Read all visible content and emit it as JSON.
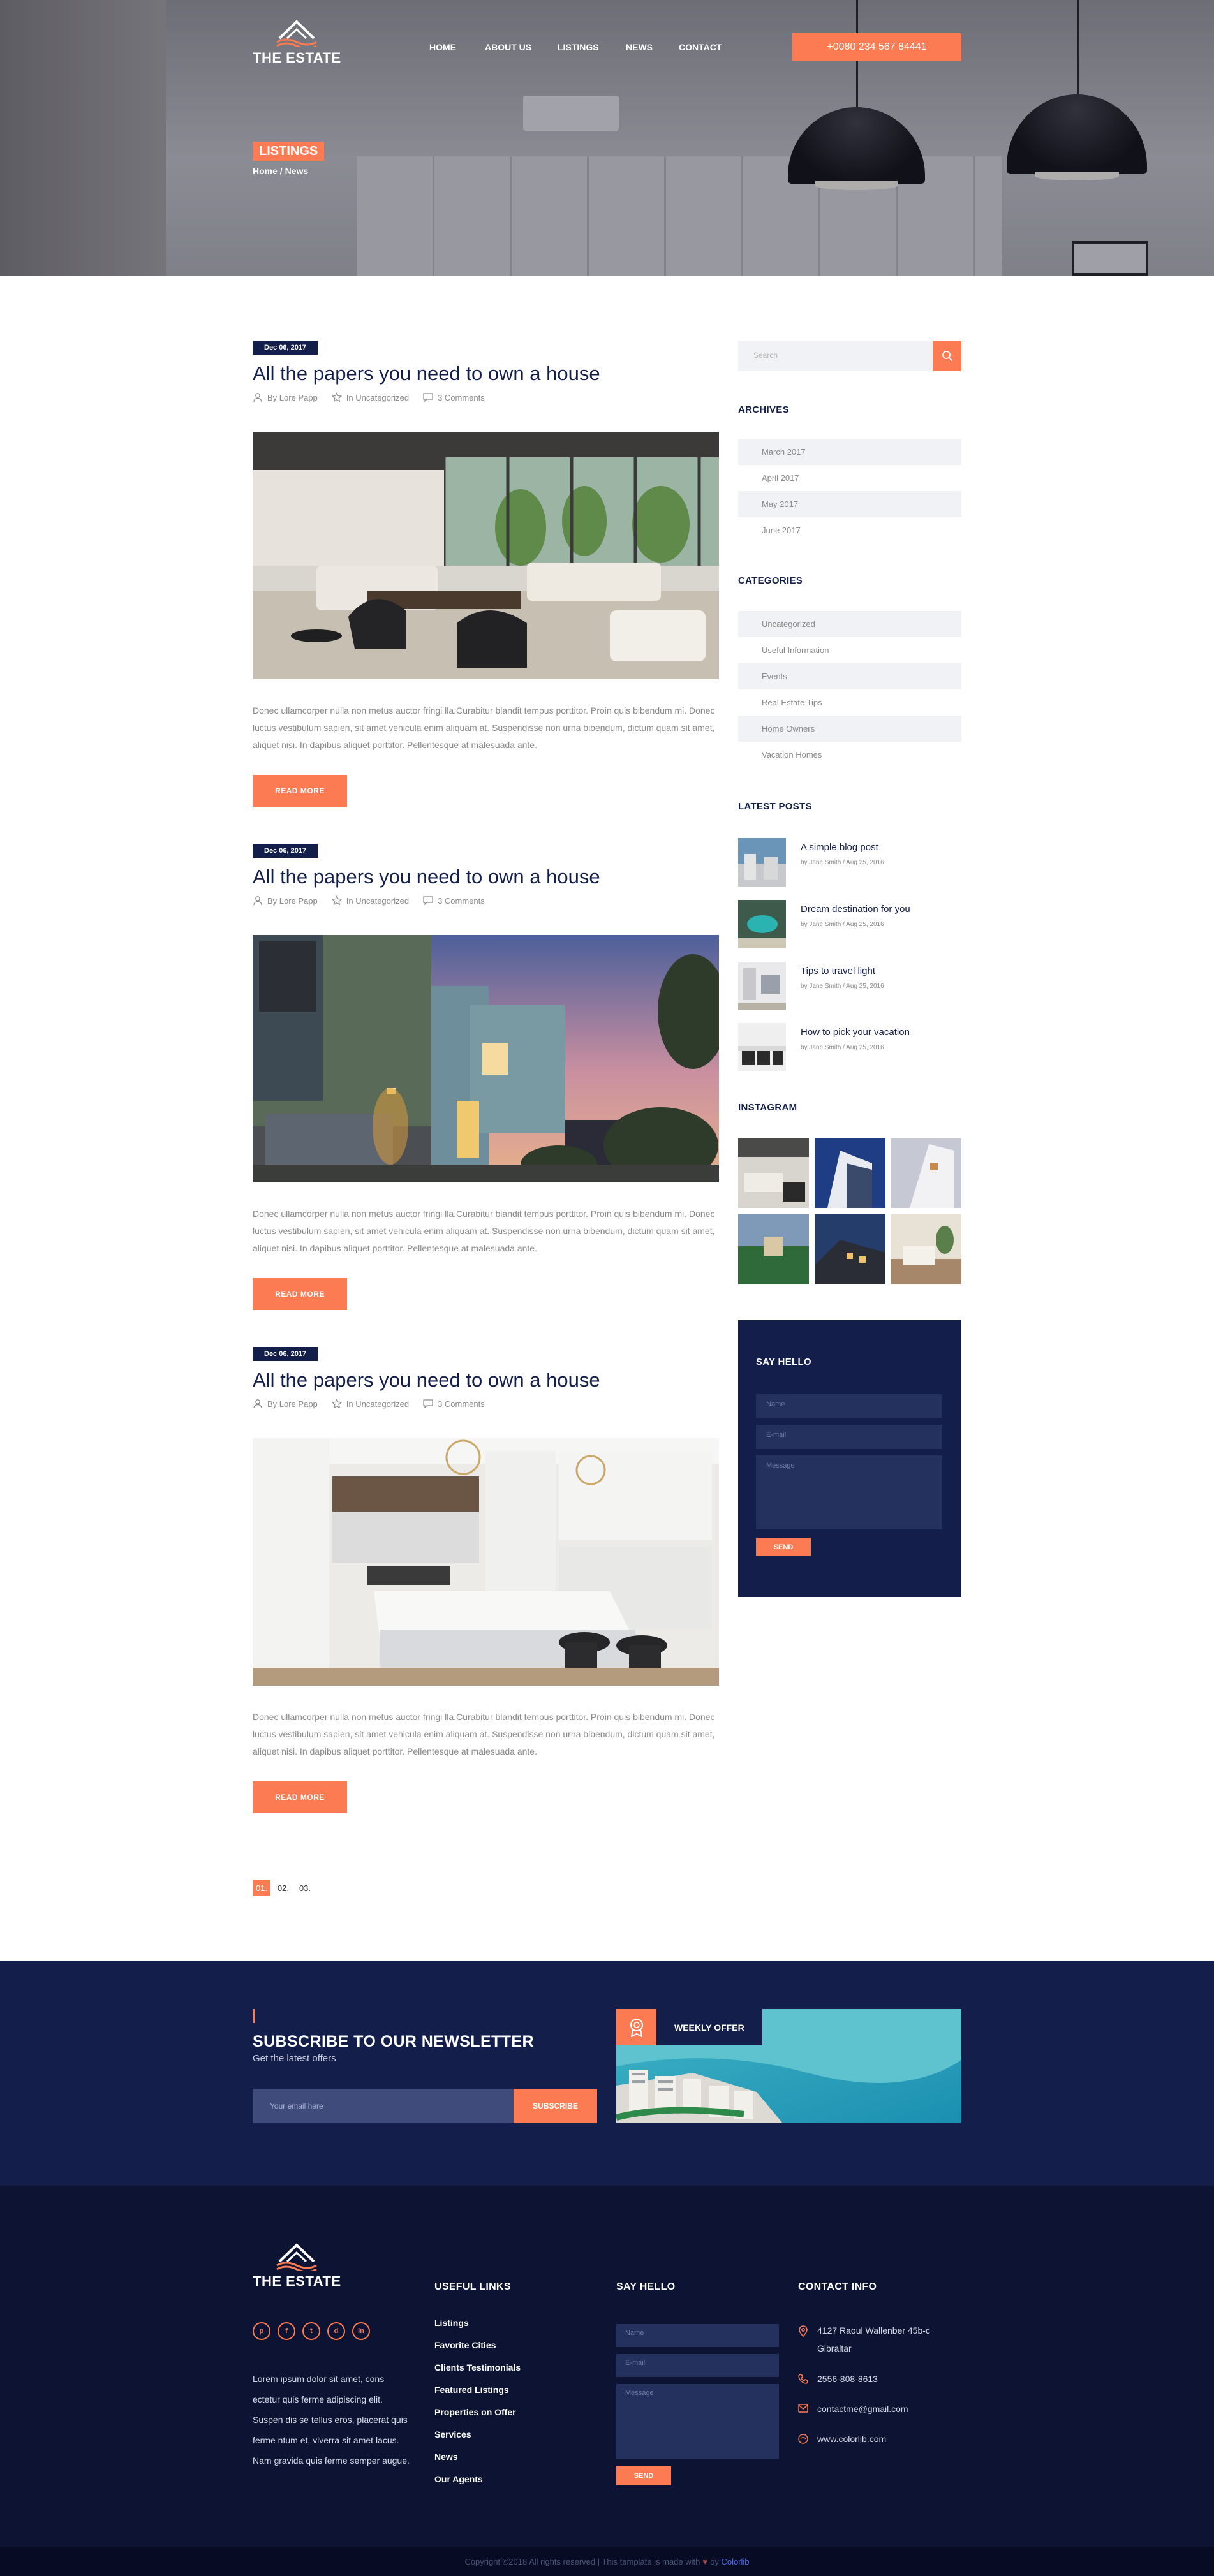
{
  "colors": {
    "accent": "#fd7b52",
    "navy": "#131e4a",
    "footer": "#0d1433"
  },
  "header": {
    "logo_text": "THE ESTATE",
    "nav": [
      "HOME",
      "ABOUT US",
      "LISTINGS",
      "NEWS",
      "CONTACT"
    ],
    "phone": "+0080 234 567 84441",
    "page_title": "LISTINGS",
    "breadcrumb": "Home / News"
  },
  "posts": [
    {
      "date": "Dec 06, 2017",
      "title": "All the papers you need to own a house",
      "author": "By Lore Papp",
      "category": "In Uncategorized",
      "comments": "3 Comments",
      "excerpt": "Donec ullamcorper nulla non metus auctor fringi lla.Curabitur blandit tempus porttitor. Proin quis bibendum mi. Donec luctus vestibulum sapien, sit amet vehicula enim aliquam at. Suspendisse non urna bibendum, dictum quam sit amet, aliquet nisi. In dapibus aliquet porttitor. Pellentesque at malesuada ante.",
      "read_more": "READ MORE"
    },
    {
      "date": "Dec 06, 2017",
      "title": "All the papers you need to own a house",
      "author": "By Lore Papp",
      "category": "In Uncategorized",
      "comments": "3 Comments",
      "excerpt": "Donec ullamcorper nulla non metus auctor fringi lla.Curabitur blandit tempus porttitor. Proin quis bibendum mi. Donec luctus vestibulum sapien, sit amet vehicula enim aliquam at. Suspendisse non urna bibendum, dictum quam sit amet, aliquet nisi. In dapibus aliquet porttitor. Pellentesque at malesuada ante.",
      "read_more": "READ MORE"
    },
    {
      "date": "Dec 06, 2017",
      "title": "All the papers you need to own a house",
      "author": "By Lore Papp",
      "category": "In Uncategorized",
      "comments": "3 Comments",
      "excerpt": "Donec ullamcorper nulla non metus auctor fringi lla.Curabitur blandit tempus porttitor. Proin quis bibendum mi. Donec luctus vestibulum sapien, sit amet vehicula enim aliquam at. Suspendisse non urna bibendum, dictum quam sit amet, aliquet nisi. In dapibus aliquet porttitor. Pellentesque at malesuada ante.",
      "read_more": "READ MORE"
    }
  ],
  "pagination": [
    "01.",
    "02.",
    "03."
  ],
  "sidebar": {
    "search_placeholder": "Search",
    "archives_title": "ARCHIVES",
    "archives": [
      "March 2017",
      "April 2017",
      "May 2017",
      "June 2017"
    ],
    "categories_title": "CATEGORIES",
    "categories": [
      "Uncategorized",
      "Useful Information",
      "Events",
      "Real Estate Tips",
      "Home Owners",
      "Vacation Homes"
    ],
    "latest_title": "LATEST POSTS",
    "latest": [
      {
        "title": "A simple blog post",
        "sub": "by Jane Smith / Aug 25, 2016"
      },
      {
        "title": "Dream destination for you",
        "sub": "by Jane Smith / Aug 25, 2016"
      },
      {
        "title": "Tips to travel light",
        "sub": "by Jane Smith / Aug 25, 2016"
      },
      {
        "title": "How to pick your vacation",
        "sub": "by Jane Smith / Aug 25, 2016"
      }
    ],
    "instagram_title": "INSTAGRAM",
    "hello": {
      "title": "SAY HELLO",
      "name": "Name",
      "email": "E-mail",
      "message": "Message",
      "send": "SEND"
    }
  },
  "newsletter": {
    "title": "SUBSCRIBE TO OUR NEWSLETTER",
    "subtitle": "Get the latest offers",
    "placeholder": "Your email here",
    "button": "SUBSCRIBE",
    "offer": "WEEKLY OFFER"
  },
  "footer": {
    "logo_text": "THE ESTATE",
    "social": [
      "p",
      "f",
      "t",
      "d",
      "in"
    ],
    "about": "Lorem ipsum dolor sit amet, cons ectetur quis ferme adipiscing elit. Suspen dis se tellus eros, placerat quis ferme ntum et, viverra sit amet lacus. Nam gravida quis ferme semper augue.",
    "links_title": "USEFUL LINKS",
    "links": [
      "Listings",
      "Favorite Cities",
      "Clients Testimonials",
      "Featured Listings",
      "Properties on Offer",
      "Services",
      "News",
      "Our Agents"
    ],
    "hello_title": "SAY HELLO",
    "hello": {
      "name": "Name",
      "email": "E-mail",
      "message": "Message",
      "send": "SEND"
    },
    "contact_title": "CONTACT INFO",
    "address": "4127 Raoul Wallenber 45b-c Gibraltar",
    "phone": "2556-808-8613",
    "email": "contactme@gmail.com",
    "web": "www.colorlib.com"
  },
  "copyright": {
    "text": "Copyright ©2018 All rights reserved | This template is made with",
    "by": "by",
    "brand": "Colorlib"
  }
}
